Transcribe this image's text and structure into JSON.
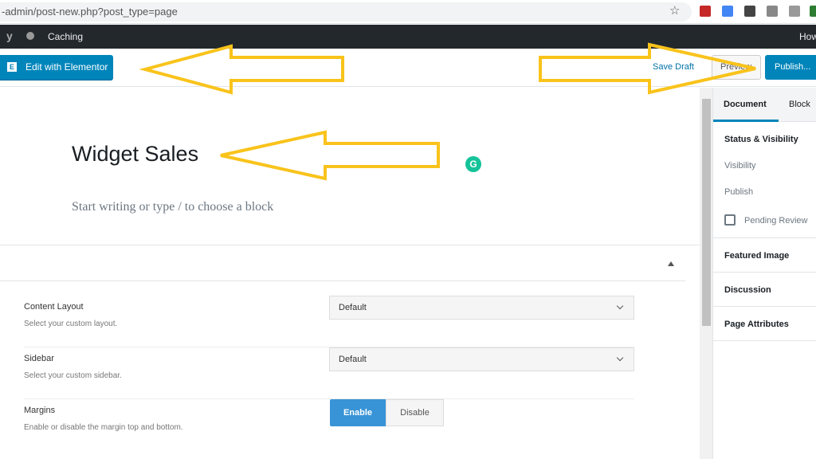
{
  "browser": {
    "url": "-admin/post-new.php?post_type=page"
  },
  "admin_bar": {
    "item": "Caching",
    "right": "How"
  },
  "toolbar": {
    "elementor": "Edit with Elementor",
    "save_draft": "Save Draft",
    "preview": "Preview",
    "publish": "Publish..."
  },
  "editor": {
    "title": "Widget Sales",
    "placeholder": "Start writing or type / to choose a block"
  },
  "meta": {
    "content_layout": {
      "label": "Content Layout",
      "desc": "Select your custom layout.",
      "value": "Default"
    },
    "sidebar": {
      "label": "Sidebar",
      "desc": "Select your custom sidebar.",
      "value": "Default"
    },
    "margins": {
      "label": "Margins",
      "desc": "Enable or disable the margin top and bottom.",
      "enable": "Enable",
      "disable": "Disable",
      "selected": "Enable"
    }
  },
  "settings": {
    "tabs": [
      "Document",
      "Block"
    ],
    "status_visibility": "Status & Visibility",
    "visibility": "Visibility",
    "publish": "Publish",
    "pending": "Pending Review",
    "featured": "Featured Image",
    "discussion": "Discussion",
    "attributes": "Page Attributes"
  },
  "colors": {
    "accent": "#0085ba",
    "arrow": "#f9c31b",
    "admin_bar": "#23282d"
  }
}
